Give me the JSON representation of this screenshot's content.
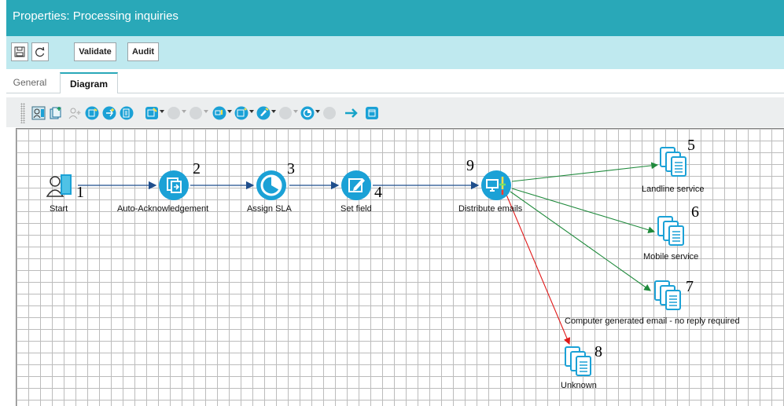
{
  "window": {
    "title": "Properties: Processing inquiries"
  },
  "actions": {
    "validate": "Validate",
    "audit": "Audit"
  },
  "tabs": [
    {
      "label": "General"
    },
    {
      "label": "Diagram"
    }
  ],
  "nodes": {
    "start": {
      "label": "Start",
      "num": "1"
    },
    "auto": {
      "label": "Auto-Acknowledgement",
      "num": "2"
    },
    "sla": {
      "label": "Assign SLA",
      "num": "3"
    },
    "setf": {
      "label": "Set field",
      "num": "4"
    },
    "dist": {
      "label": "Distribute emails",
      "num": "9"
    },
    "land": {
      "label": "Landline service",
      "num": "5"
    },
    "mobile": {
      "label": "Mobile service",
      "num": "6"
    },
    "cge": {
      "label": "Computer generated email - no reply required",
      "num": "7"
    },
    "unknown": {
      "label": "Unknown",
      "num": "8"
    }
  },
  "colors": {
    "header": "#29a8b8",
    "actionbar": "#bfe9ef",
    "node": "#1ba1d6",
    "link_primary": "#1f4e8c",
    "link_green": "#1f8a3c",
    "link_red": "#e01818"
  },
  "icons": [
    "save-icon",
    "refresh-icon",
    "start-node-icon",
    "activity-icon",
    "queue-icon"
  ]
}
